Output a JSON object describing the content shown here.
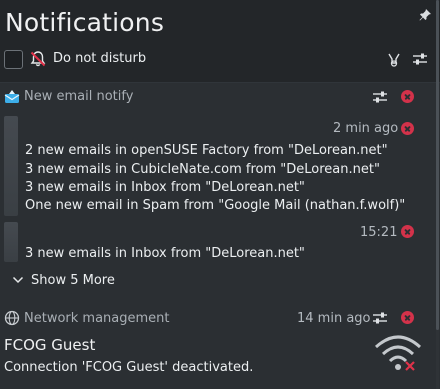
{
  "header": {
    "title": "Notifications"
  },
  "dnd": {
    "label": "Do not disturb"
  },
  "groups": [
    {
      "app_name": "New email notify",
      "notifications": [
        {
          "time": "2 min ago",
          "lines": [
            "2 new emails in openSUSE Factory from \"DeLorean.net\"",
            "3 new emails in CubicleNate.com from \"DeLorean.net\"",
            "3 new emails in Inbox from \"DeLorean.net\"",
            "One new email in Spam from \"Google Mail (nathan.f.wolf)\""
          ]
        },
        {
          "time": "15:21",
          "lines": [
            "3 new emails in Inbox from \"DeLorean.net\""
          ]
        }
      ],
      "show_more": "Show 5 More"
    },
    {
      "app_name": "Network management",
      "time": "14 min ago",
      "heading": "FCOG Guest",
      "body": "Connection 'FCOG Guest' deactivated."
    }
  ],
  "colors": {
    "accent_red": "#d3324a",
    "background": "#232629"
  }
}
